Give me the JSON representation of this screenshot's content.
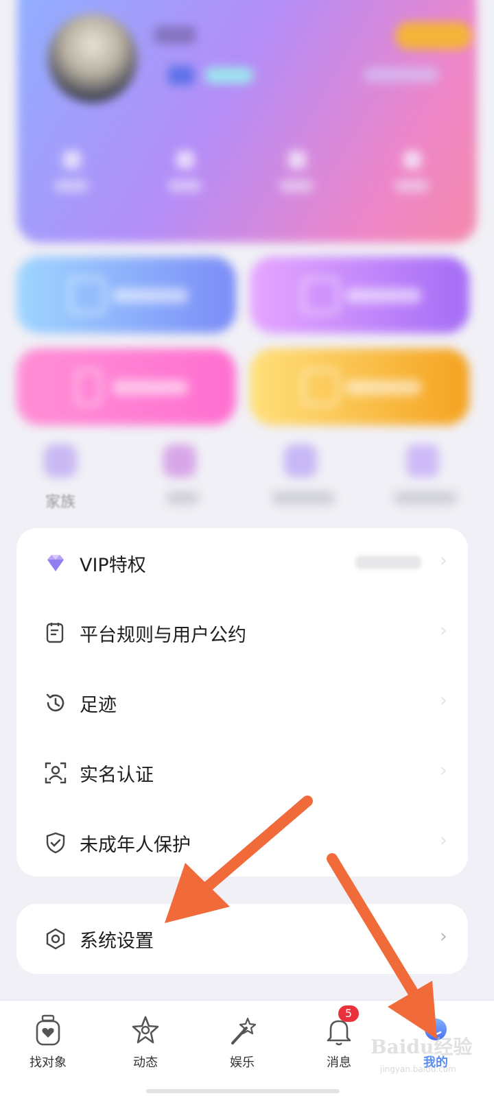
{
  "top_section": {
    "family_label": "家族"
  },
  "menu": {
    "items": [
      {
        "label": "VIP特权",
        "icon": "diamond-icon"
      },
      {
        "label": "平台规则与用户公约",
        "icon": "document-icon"
      },
      {
        "label": "足迹",
        "icon": "history-clock-icon"
      },
      {
        "label": "实名认证",
        "icon": "face-scan-icon"
      },
      {
        "label": "未成年人保护",
        "icon": "shield-check-icon"
      }
    ],
    "chevron": "›"
  },
  "settings": {
    "label": "系统设置",
    "icon": "settings-hexagon-icon",
    "chevron": "›"
  },
  "bottom_nav": {
    "items": [
      {
        "label": "找对象",
        "icon": "heart-jar-icon"
      },
      {
        "label": "动态",
        "icon": "star-icon"
      },
      {
        "label": "娱乐",
        "icon": "magic-wand-icon"
      },
      {
        "label": "消息",
        "icon": "bell-icon",
        "badge": "5"
      },
      {
        "label": "我的",
        "icon": "profile-avatar-icon",
        "active": true
      }
    ],
    "active_color": "#5b8def"
  },
  "watermark": {
    "brand": "Baidu经验",
    "url": "jingyan.baidu.com"
  },
  "colors": {
    "annotation_arrow": "#f06a3a",
    "badge": "#e8313a"
  }
}
